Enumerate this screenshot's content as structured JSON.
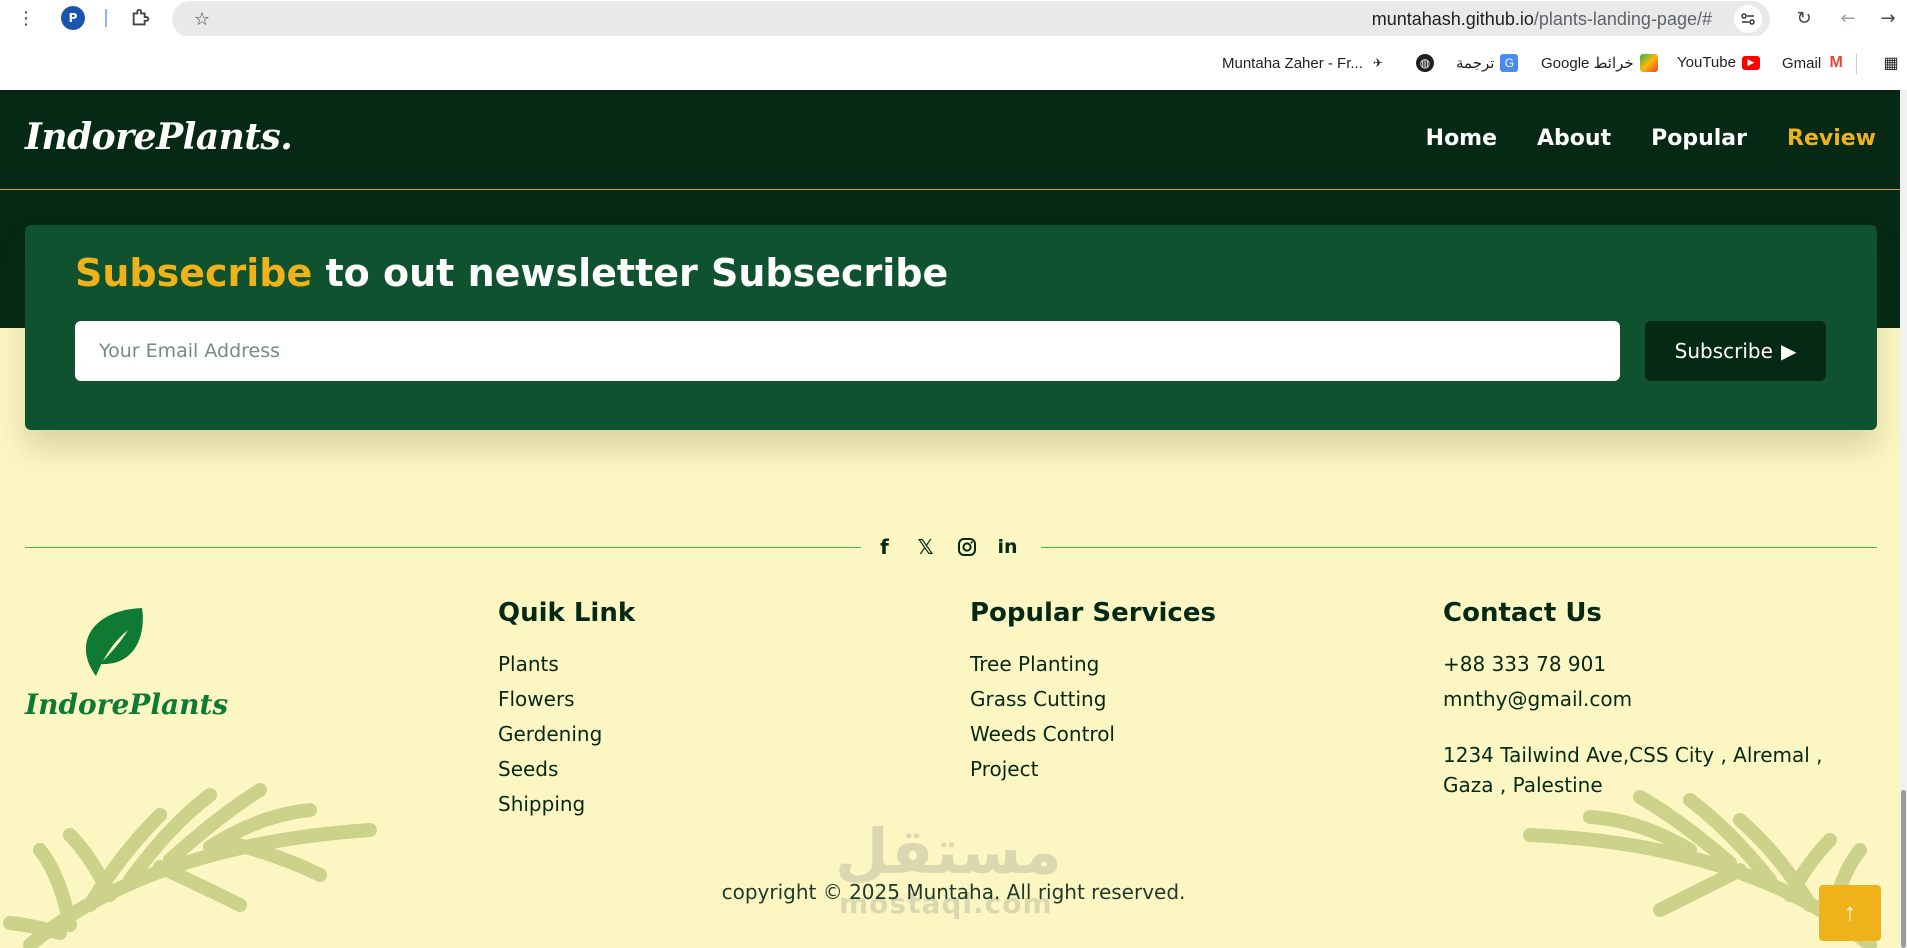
{
  "browser": {
    "profile_initial": "P",
    "url_host": "muntahash.github.io",
    "url_path": "/plants-landing-page/#",
    "bookmarks": [
      {
        "label": "Muntaha Zaher - Fr...",
        "icon": "freelancer-icon"
      },
      {
        "label": "",
        "icon": "globe-icon"
      },
      {
        "label": "ترجمة",
        "icon": "translate-icon"
      },
      {
        "label": "Google خرائط",
        "icon": "maps-icon"
      },
      {
        "label": "YouTube",
        "icon": "youtube-icon"
      },
      {
        "label": "Gmail",
        "icon": "gmail-icon"
      }
    ]
  },
  "header": {
    "logo": "IndorePlants.",
    "nav": [
      {
        "label": "Home",
        "active": false
      },
      {
        "label": "About",
        "active": false
      },
      {
        "label": "Popular",
        "active": false
      },
      {
        "label": "Review",
        "active": true
      }
    ]
  },
  "newsletter": {
    "title_highlight": "Subsecribe",
    "title_rest": " to out newsletter Subsecribe",
    "email_placeholder": "Your Email Address",
    "button_label": "Subscribe"
  },
  "social": [
    "facebook-icon",
    "x-icon",
    "instagram-icon",
    "linkedin-icon"
  ],
  "footer": {
    "brand_name": "IndorePlants",
    "quick_links": {
      "title": "Quik Link",
      "items": [
        "Plants",
        "Flowers",
        "Gerdening",
        "Seeds",
        "Shipping"
      ]
    },
    "services": {
      "title": "Popular Services",
      "items": [
        "Tree Planting",
        "Grass Cutting",
        "Weeds Control",
        "Project"
      ]
    },
    "contact": {
      "title": "Contact Us",
      "phone": "+88 333 78 901",
      "email": "mnthy@gmail.com",
      "address": "1234 Tailwind Ave,CSS City , Alremal , Gaza , Palestine"
    },
    "copyright": "copyright © 2025 Muntaha. All right reserved."
  },
  "watermark": {
    "arabic": "مستقل",
    "latin": "mostaql.com"
  },
  "colors": {
    "dark_green": "#052915",
    "newsletter_green": "#0f5230",
    "accent_yellow": "#f0b21a",
    "cream": "#fcf6c2",
    "brand_green": "#0e7a34"
  }
}
